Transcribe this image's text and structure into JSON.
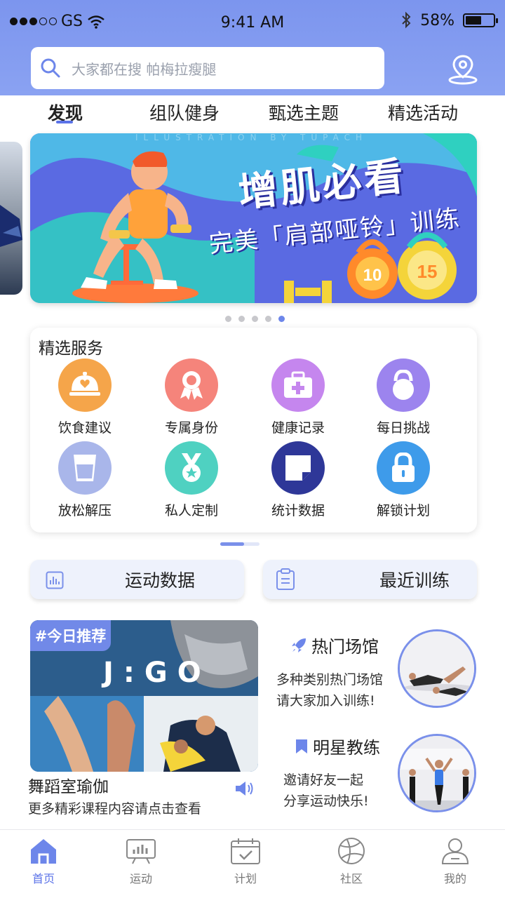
{
  "status_bar": {
    "carrier": "GS",
    "time": "9:41 AM",
    "battery": "58%",
    "battery_level": 0.58
  },
  "search": {
    "placeholder": "大家都在搜 帕梅拉瘦腿"
  },
  "tabs": [
    {
      "label": "发现",
      "active": true
    },
    {
      "label": "组队健身",
      "active": false
    },
    {
      "label": "甄选主题",
      "active": false
    },
    {
      "label": "精选活动",
      "active": false
    }
  ],
  "banner": {
    "title": "增肌必看",
    "subtitle": "完美「肩部哑铃」训练",
    "watermark": "ILLUSTRATION BY TUPACH",
    "weight_1": "10",
    "weight_2": "15",
    "page_count": 5,
    "active_page": 5
  },
  "services": {
    "title": "精选服务",
    "items": [
      {
        "label": "饮食建议",
        "icon": "food-cloche-icon",
        "color": "#f5a54a"
      },
      {
        "label": "专属身份",
        "icon": "ribbon-badge-icon",
        "color": "#f5847b"
      },
      {
        "label": "健康记录",
        "icon": "medical-kit-icon",
        "color": "#c586ee"
      },
      {
        "label": "每日挑战",
        "icon": "kettlebell-icon",
        "color": "#9c84ee"
      },
      {
        "label": "放松解压",
        "icon": "cup-icon",
        "color": "#a9b6ea"
      },
      {
        "label": "私人定制",
        "icon": "medal-icon",
        "color": "#4fd1c1"
      },
      {
        "label": "统计数据",
        "icon": "note-icon",
        "color": "#2e3798"
      },
      {
        "label": "解锁计划",
        "icon": "lock-icon",
        "color": "#3e9bea"
      }
    ]
  },
  "quick_buttons": {
    "sport_data": "运动数据",
    "recent_training": "最近训练"
  },
  "recommend": {
    "tag": "#今日推荐",
    "brand": "J:GO",
    "title": "舞蹈室瑜伽",
    "subtitle": "更多精彩课程内容请点击查看"
  },
  "features": [
    {
      "title": "热门场馆",
      "desc_1": "多种类别热门场馆",
      "desc_2": "请大家加入训练!",
      "icon": "rocket-icon"
    },
    {
      "title": "明星教练",
      "desc_1": "邀请好友一起",
      "desc_2": "分享运动快乐!",
      "icon": "bookmark-icon"
    }
  ],
  "nav": [
    {
      "label": "首页",
      "icon": "home-icon",
      "active": true
    },
    {
      "label": "运动",
      "icon": "stats-icon",
      "active": false
    },
    {
      "label": "计划",
      "icon": "calendar-icon",
      "active": false
    },
    {
      "label": "社区",
      "icon": "community-icon",
      "active": false
    },
    {
      "label": "我的",
      "icon": "user-icon",
      "active": false
    }
  ],
  "colors": {
    "header": "#7c95ee",
    "accent": "#5b73e8",
    "card_bg": "#eef2fc"
  }
}
